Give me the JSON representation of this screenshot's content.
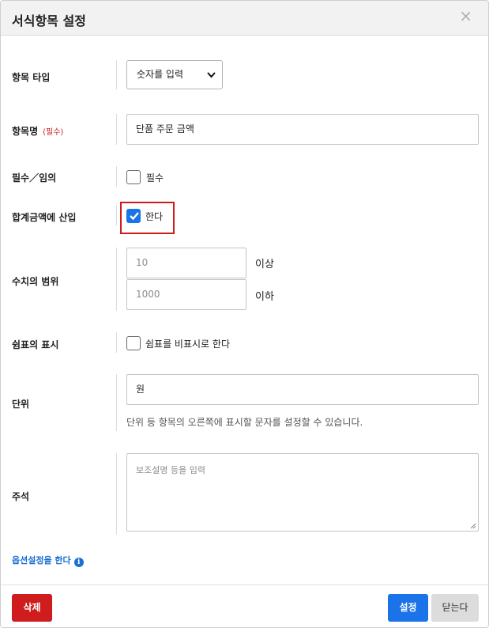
{
  "dialog": {
    "title": "서식항목 설정",
    "close_glyph": "×"
  },
  "fields": {
    "item_type": {
      "label": "항목 타입",
      "selected": "숫자를 입력"
    },
    "item_name": {
      "label": "항목명",
      "required_tag": "(필수)",
      "value": "단품 주문 금액"
    },
    "required": {
      "label": "필수／임의",
      "checkbox_label": "필수",
      "checked": false
    },
    "add_to_total": {
      "label": "합계금액에 산입",
      "checkbox_label": "한다",
      "checked": true
    },
    "range": {
      "label": "수치의 범위",
      "min_placeholder": "10",
      "min_suffix": "이상",
      "max_placeholder": "1000",
      "max_suffix": "이하"
    },
    "comma": {
      "label": "쉼표의 표시",
      "checkbox_label": "쉼표를 비표시로 한다",
      "checked": false
    },
    "unit": {
      "label": "단위",
      "value": "원",
      "help": "단위 등 항목의 오른쪽에 표시할 문자를 설정할 수 있습니다."
    },
    "note": {
      "label": "주석",
      "placeholder": "보조설명 등을 입력"
    }
  },
  "option_link": {
    "label": "옵션설정을 한다",
    "icon": "info-icon"
  },
  "footer": {
    "delete_label": "삭제",
    "save_label": "설정",
    "close_label": "닫는다"
  },
  "colors": {
    "primary": "#1a73e8",
    "danger": "#cf1d1d",
    "highlight": "#d01b1b",
    "link": "#1a6fd3"
  }
}
